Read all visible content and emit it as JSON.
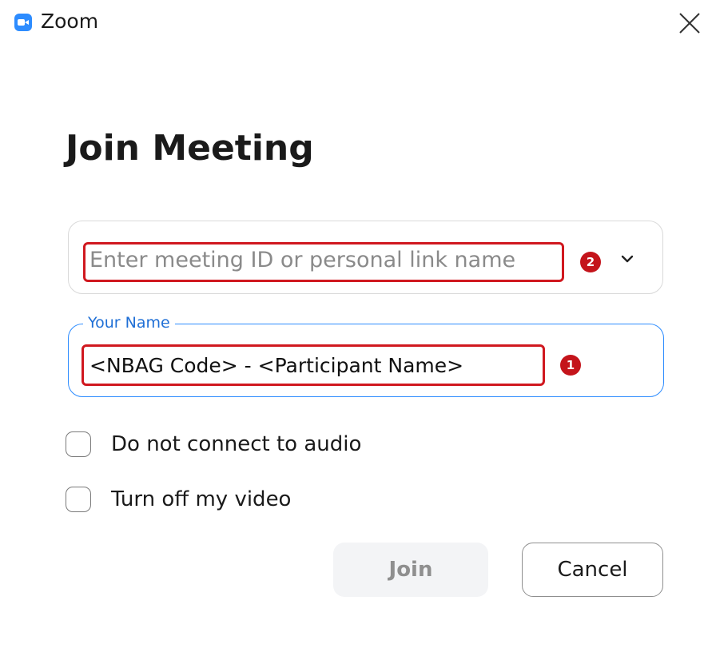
{
  "window": {
    "title": "Zoom"
  },
  "dialog": {
    "heading": "Join Meeting",
    "meeting_id": {
      "value": "",
      "placeholder": "Enter meeting ID or personal link name",
      "callout_number": "2"
    },
    "your_name": {
      "label": "Your Name",
      "value": "<NBAG Code> - <Participant Name>",
      "callout_number": "1"
    },
    "options": [
      {
        "label": "Do not connect to audio",
        "checked": false
      },
      {
        "label": "Turn off my video",
        "checked": false
      }
    ],
    "buttons": {
      "join_label": "Join",
      "cancel_label": "Cancel"
    }
  },
  "colors": {
    "brand_blue": "#2d8cff",
    "focus_blue": "#2d8cff",
    "annotation_red": "#d0181f",
    "disabled_bg": "#f3f4f6",
    "disabled_text": "#8f8f8f"
  },
  "icons": {
    "app": "zoom-camera-icon",
    "close": "close-icon",
    "dropdown": "chevron-down-icon"
  }
}
